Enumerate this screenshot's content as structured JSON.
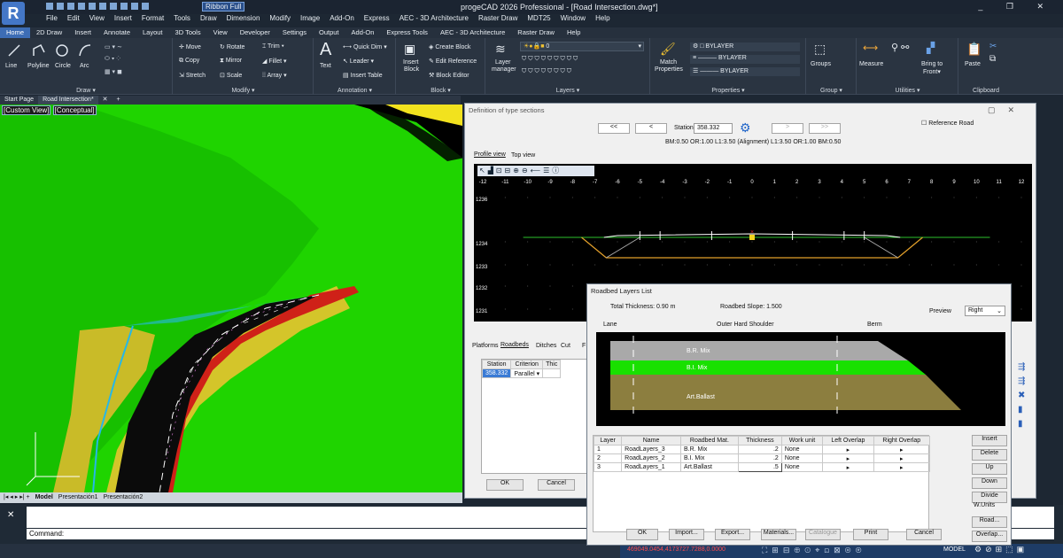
{
  "app": {
    "title": "progeCAD 2026 Professional - [Road Intersection.dwg*]",
    "logo": "R",
    "ribbon_toggle": "Ribbon Full",
    "window_controls": "_ ❐ ✕"
  },
  "menu": [
    "File",
    "Edit",
    "View",
    "Insert",
    "Format",
    "Tools",
    "Draw",
    "Dimension",
    "Modify",
    "Image",
    "Add-On",
    "Express",
    "AEC - 3D Architecture",
    "Raster Draw",
    "MDT25",
    "Window",
    "Help"
  ],
  "ribbon_tabs": [
    "Home",
    "2D Draw",
    "Insert",
    "Annotate",
    "Layout",
    "3D Tools",
    "View",
    "Developer",
    "Settings",
    "Output",
    "Add-On",
    "Express Tools",
    "AEC - 3D Architecture",
    "Raster Draw",
    "Help"
  ],
  "ribbon": {
    "draw": {
      "label": "Draw ▾",
      "line": "Line",
      "polyline": "Polyline",
      "circle": "Circle",
      "arc": "Arc"
    },
    "modify": {
      "label": "Modify ▾",
      "move": "Move",
      "rotate": "Rotate",
      "trim": "Trim ▾",
      "copy": "Copy",
      "mirror": "Mirror",
      "fillet": "Fillet ▾",
      "stretch": "Stretch",
      "scale": "Scale",
      "array": "Array ▾"
    },
    "annotation": {
      "label": "Annotation ▾",
      "text": "Text",
      "quick_dim": "Quick Dim ▾",
      "leader": "Leader ▾",
      "insert_table": "Insert Table"
    },
    "block": {
      "label": "Block ▾",
      "insert": "Insert",
      "insert2": "Block",
      "create": "Create Block",
      "edit_ref": "Edit Reference",
      "editor": "Block Editor"
    },
    "layers": {
      "label": "Layers ▾",
      "manager": "Layer",
      "manager2": "manager",
      "current": "0"
    },
    "properties": {
      "label": "Properties ▾",
      "match": "Match",
      "match2": "Properties",
      "bylayer1": "BYLAYER",
      "bylayer2": "BYLAYER",
      "bylayer3": "BYLAYER"
    },
    "group": {
      "label": "Group ▾",
      "groups": "Groups"
    },
    "utilities": {
      "label": "Utilities ▾",
      "measure": "Measure",
      "bring": "Bring to",
      "front": "Front▾"
    },
    "clipboard": {
      "label": "Clipboard",
      "paste": "Paste"
    }
  },
  "file_tabs": [
    "Start Page",
    "Road Intersection*",
    "✕",
    "+"
  ],
  "viewport": {
    "view": "[Custom View]",
    "style": "[Conceptual]"
  },
  "layout_tabs": [
    "Model",
    "Presentación1",
    "Presentación2"
  ],
  "command": {
    "prompt": "Command:"
  },
  "status": {
    "coords": "469049.0454,4173727.7288,0.0000",
    "model": "MODEL"
  },
  "type_sections": {
    "title": "Definition of type sections",
    "nav_first": "<<",
    "nav_prev": "<",
    "nav_next": ">",
    "nav_last": ">>",
    "station_label": "Station",
    "station_value": "358.332",
    "reference_road": "Reference Road",
    "info": "BM:0.50 OR:1.00 L1:3.50 (Alignment) L1:3.50 OR:1.00 BM:0.50",
    "tabs": [
      "Profile view",
      "Top view"
    ],
    "x_ticks": [
      "-12",
      "-11",
      "-10",
      "-9",
      "-8",
      "-7",
      "-6",
      "-5",
      "-4",
      "-3",
      "-2",
      "-1",
      "0",
      "1",
      "2",
      "3",
      "4",
      "5",
      "6",
      "7",
      "8",
      "9",
      "10",
      "11",
      "12"
    ],
    "y_ticks": [
      "1236",
      "1234",
      "1233",
      "1232",
      "1231"
    ],
    "lower_tabs": [
      "Platforms",
      "Roadbeds",
      "Ditches",
      "Cut",
      "F"
    ],
    "grid_head": [
      "Station",
      "Criterion",
      "Thic"
    ],
    "grid_row": [
      "358.332",
      "Parallel"
    ],
    "ok": "OK",
    "cancel": "Cancel"
  },
  "roadbed": {
    "title": "Roadbed Layers List",
    "total_thickness": "Total Thickness: 0.90 m",
    "slope": "Roadbed Slope: 1.500",
    "preview_label": "Preview",
    "preview_value": "Right",
    "zones": [
      "Lane",
      "Outer Hard Shoulder",
      "Berm"
    ],
    "layers_preview": [
      "B.R. Mix",
      "B.I. Mix",
      "Art.Ballast"
    ],
    "columns": [
      "Layer",
      "Name",
      "Roadbed Mat.",
      "Thickness",
      "Work unit",
      "Left Overlap",
      "Right Overlap"
    ],
    "rows": [
      {
        "n": "1",
        "name": "RoadLayers_3",
        "mat": "B.R. Mix",
        "th": ".2",
        "unit": "None",
        "l": "▸",
        "r": "▸"
      },
      {
        "n": "2",
        "name": "RoadLayers_2",
        "mat": "B.I. Mix",
        "th": ".2",
        "unit": "None",
        "l": "▸",
        "r": "▸"
      },
      {
        "n": "3",
        "name": "RoadLayers_1",
        "mat": "Art.Ballast",
        "th": ".5",
        "unit": "None",
        "l": "▸",
        "r": "▸"
      }
    ],
    "side_buttons": [
      "Insert",
      "Delete",
      "Up",
      "Down",
      "Divide",
      "W.Units",
      "Road...",
      "Overlap..."
    ],
    "bottom_buttons": [
      "OK",
      "Import...",
      "Export...",
      "Materials...",
      "Catalogue",
      "Print",
      "Cancel"
    ]
  },
  "colors": {
    "accent": "#3d6db5",
    "green": "#19d400",
    "yellow": "#d4c52a",
    "red": "#e0241a"
  }
}
